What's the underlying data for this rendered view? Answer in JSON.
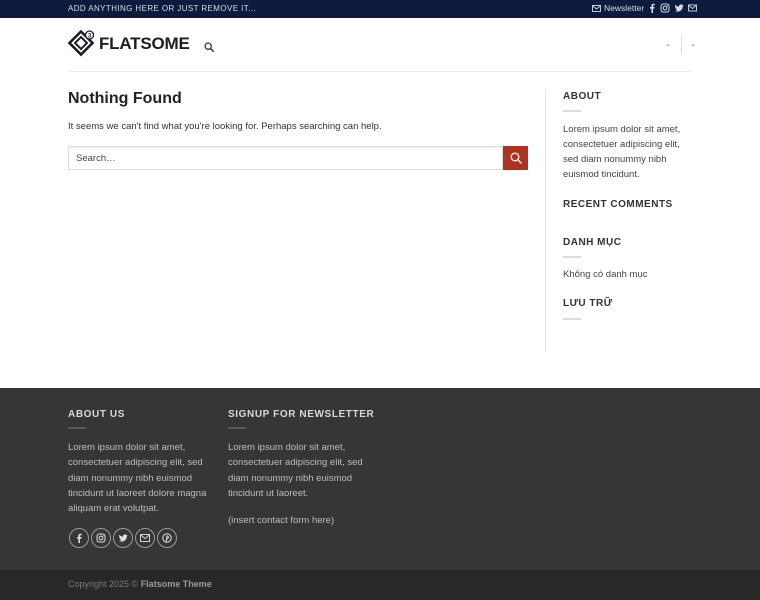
{
  "topbar": {
    "message": "ADD ANYTHING HERE OR JUST REMOVE IT...",
    "newsletter_label": "Newsletter"
  },
  "header": {
    "logo_text": "FLATSOME",
    "right_item_1": "-",
    "right_item_2": "-"
  },
  "main": {
    "title": "Nothing Found",
    "description": "It seems we can't find what you're looking for. Perhaps searching can help.",
    "search_placeholder": "Search…"
  },
  "sidebar": {
    "about_title": "ABOUT",
    "about_text": "Lorem ipsum dolor sit amet, consectetuer adipiscing elit, sed diam nonummy nibh euismod tincidunt.",
    "recent_comments_title": "RECENT COMMENTS",
    "categories_title": "DANH MỤC",
    "categories_empty": "Không có danh mục",
    "archives_title": "LƯU TRỮ"
  },
  "footer": {
    "about_title": "ABOUT US",
    "about_text": "Lorem ipsum dolor sit amet, consectetuer adipiscing elit, sed diam nonummy nibh euismod tincidunt ut laoreet dolore magna aliquam erat volutpat.",
    "newsletter_title": "SIGNUP FOR NEWSLETTER",
    "newsletter_text": "Lorem ipsum dolor sit amet, consectetuer adipiscing elit, sed diam nonummy nibh euismod tincidunt ut laoreet.",
    "contact_placeholder": "(insert contact form here)",
    "copyright_prefix": "Copyright 2025 © ",
    "copyright_brand": "Flatsome Theme"
  },
  "icons": [
    "mail-icon",
    "facebook-icon",
    "instagram-icon",
    "twitter-icon",
    "email-icon",
    "search-icon",
    "pinterest-icon"
  ],
  "colors": {
    "topbar_bg": "#0d1b3e",
    "accent": "#b03320",
    "footer_bg": "#363636",
    "bottom_bg": "#282828"
  }
}
